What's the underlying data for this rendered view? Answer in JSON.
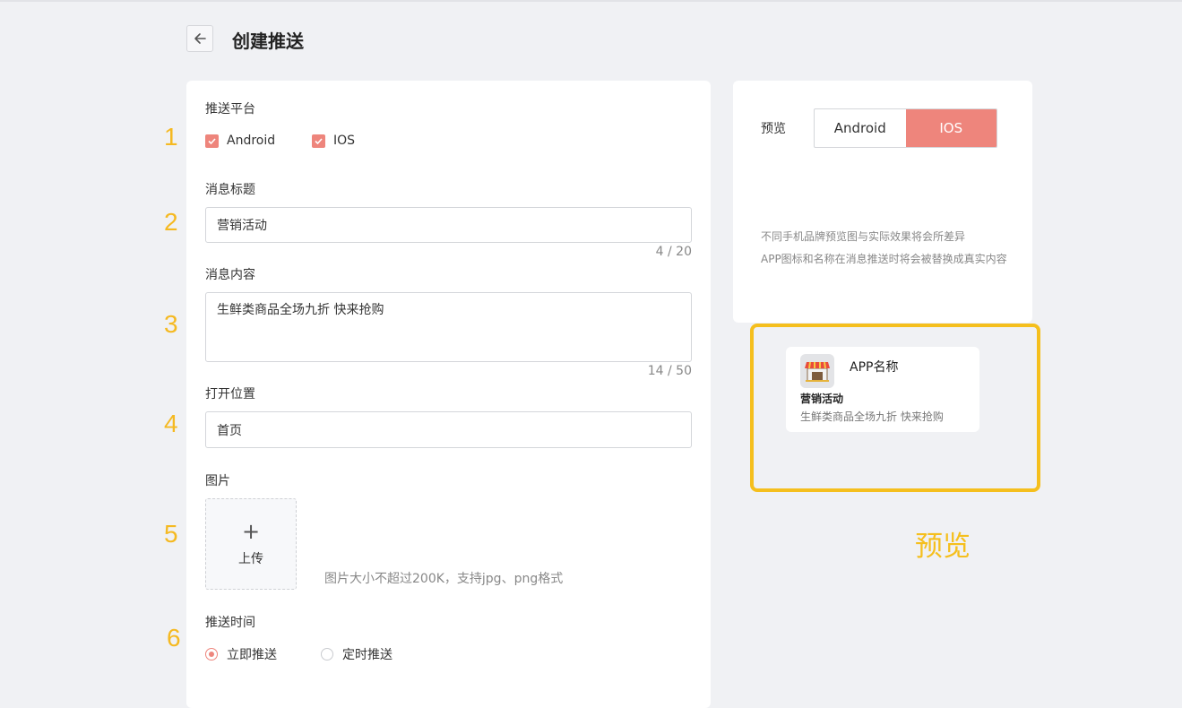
{
  "page": {
    "title": "创建推送"
  },
  "form": {
    "platform": {
      "number": "1",
      "label": "推送平台",
      "options": [
        {
          "label": "Android",
          "checked": true
        },
        {
          "label": "IOS",
          "checked": true
        }
      ]
    },
    "title_field": {
      "number": "2",
      "label": "消息标题",
      "value": "营销活动",
      "counter": "4 / 20"
    },
    "content_field": {
      "number": "3",
      "label": "消息内容",
      "value": "生鲜类商品全场九折 快来抢购",
      "counter": "14 / 50"
    },
    "open_location": {
      "number": "4",
      "label": "打开位置",
      "value": "首页"
    },
    "image": {
      "number": "5",
      "label": "图片",
      "upload_plus": "+",
      "upload_label": "上传",
      "hint": "图片大小不超过200K，支持jpg、png格式"
    },
    "push_time": {
      "number": "6",
      "label": "推送时间",
      "options": [
        {
          "label": "立即推送",
          "selected": true
        },
        {
          "label": "定时推送",
          "selected": false
        }
      ]
    }
  },
  "preview": {
    "label": "预览",
    "tabs": [
      {
        "label": "Android",
        "active": false
      },
      {
        "label": "IOS",
        "active": true
      }
    ],
    "note1": "不同手机品牌预览图与实际效果将会所差异",
    "note2": "APP图标和名称在消息推送时将会被替换成真实内容",
    "notification": {
      "app_name": "APP名称",
      "title": "营销活动",
      "body": "生鲜类商品全场九折 快来抢购",
      "icon": "store-icon"
    },
    "annotation": "预览"
  },
  "colors": {
    "accent": "#ee857c",
    "highlight": "#f5bf1d",
    "page_bg": "#f0f1f4"
  }
}
